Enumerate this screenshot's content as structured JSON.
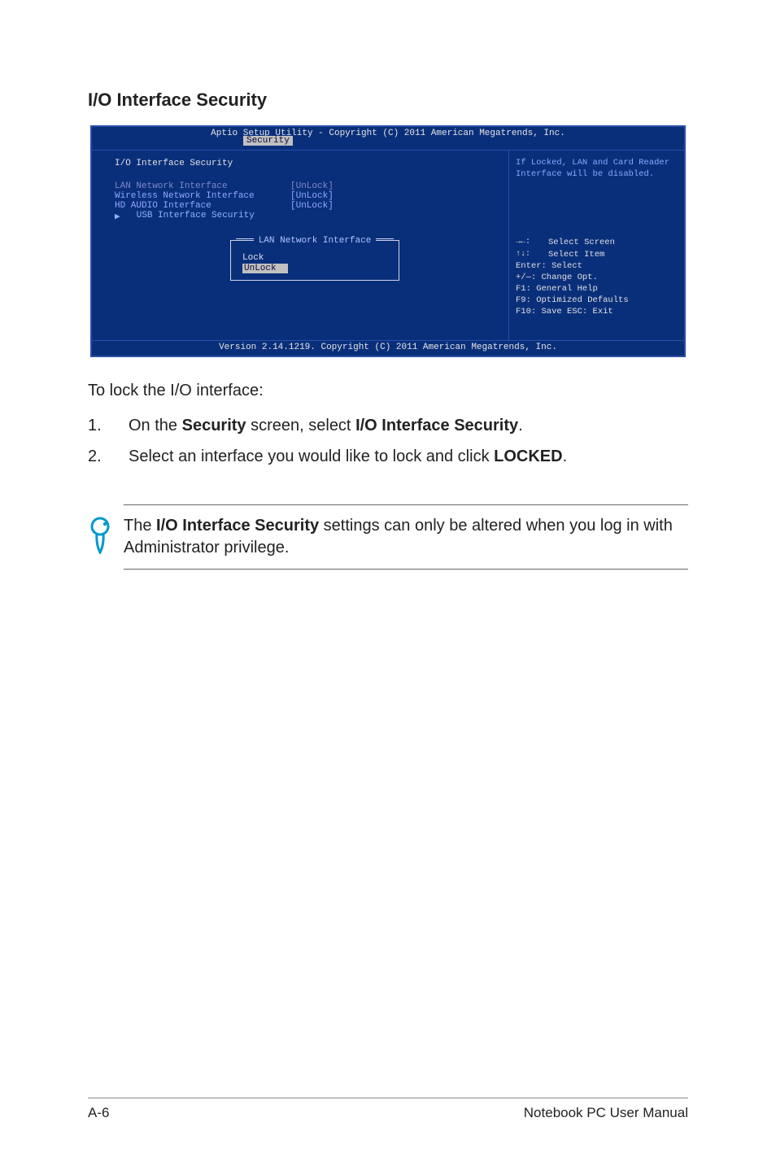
{
  "heading": "I/O Interface Security",
  "bios": {
    "titlebar": "Aptio Setup Utility - Copyright (C) 2011 American Megatrends, Inc.",
    "active_tab": "Security",
    "panel_title": "I/O Interface Security",
    "rows": {
      "lan": {
        "label": "LAN Network Interface",
        "value": "[UnLock]"
      },
      "wireless": {
        "label": "Wireless Network Interface",
        "value": "[UnLock]"
      },
      "hdaudio": {
        "label": "HD AUDIO Interface",
        "value": "[UnLock]"
      },
      "usb_sub": {
        "label": "USB Interface Security"
      }
    },
    "popup": {
      "title": "LAN Network Interface",
      "opt_lock": "Lock",
      "opt_unlock": "UnLock"
    },
    "help": {
      "desc": "If Locked, LAN and Card Reader Interface will be disabled.",
      "nav": {
        "select_screen": "Select Screen",
        "select_item": "Select Item",
        "enter": "Enter: Select",
        "change": "+/—:  Change Opt.",
        "f1": "F1:    General Help",
        "f9": "F9:    Optimized Defaults",
        "f10": "F10:  Save   ESC: Exit",
        "arrows_lr": "→←:",
        "arrows_ud": "↑↓:"
      }
    },
    "footer": "Version 2.14.1219. Copyright (C) 2011 American Megatrends, Inc."
  },
  "instructions": {
    "intro": "To lock the I/O interface:",
    "step1_num": "1.",
    "step1_a": "On the ",
    "step1_b": "Security",
    "step1_c": " screen, select ",
    "step1_d": "I/O Interface Security",
    "step1_e": ".",
    "step2_num": "2.",
    "step2_a": "Select an interface you would like to lock and click ",
    "step2_b": "LOCKED",
    "step2_c": "."
  },
  "note": {
    "a": "The ",
    "b": "I/O Interface Security",
    "c": " settings can only be altered when you log in with Administrator privilege."
  },
  "footer": {
    "left": "A-6",
    "right": "Notebook PC User Manual"
  }
}
